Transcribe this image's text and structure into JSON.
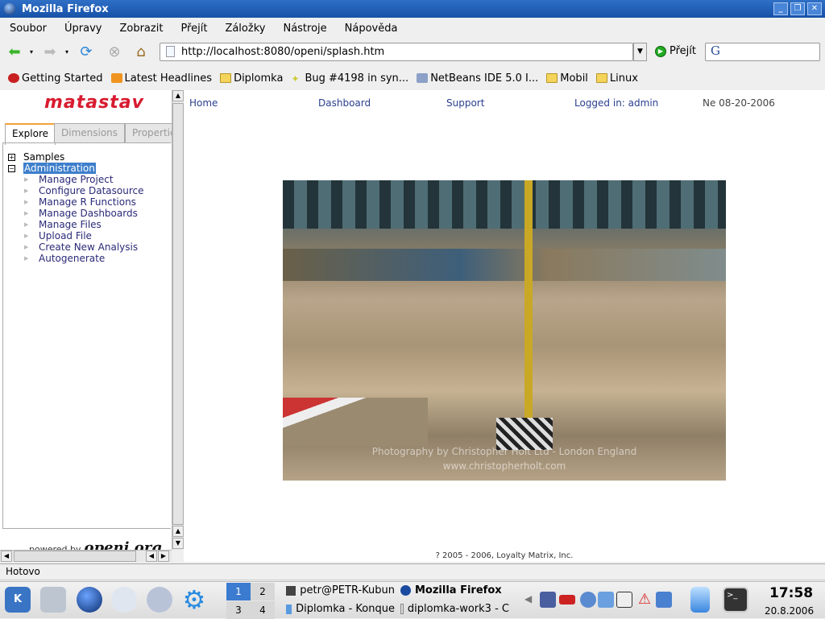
{
  "window": {
    "title": "Mozilla Firefox"
  },
  "menu": [
    "Soubor",
    "Úpravy",
    "Zobrazit",
    "Přejít",
    "Záložky",
    "Nástroje",
    "Nápověda"
  ],
  "toolbar": {
    "url": "http://localhost:8080/openi/splash.htm",
    "go_label": "Přejít",
    "search_value": "",
    "search_engine_icon": "google-icon"
  },
  "bookmarks": [
    {
      "label": "Getting Started",
      "icon": "firefox-icon"
    },
    {
      "label": "Latest Headlines",
      "icon": "rss-icon"
    },
    {
      "label": "Diplomka",
      "icon": "folder-icon"
    },
    {
      "label": "Bug #4198 in syn...",
      "icon": "bug-icon"
    },
    {
      "label": "NetBeans IDE 5.0 I...",
      "icon": "netbeans-icon"
    },
    {
      "label": "Mobil",
      "icon": "folder-icon"
    },
    {
      "label": "Linux",
      "icon": "folder-icon"
    }
  ],
  "sidebar": {
    "brand": "matastav",
    "tabs": [
      "Explore",
      "Dimensions",
      "Properties"
    ],
    "tree": [
      {
        "label": "Samples",
        "expanded": false
      },
      {
        "label": "Administration",
        "expanded": true,
        "selected": true
      }
    ],
    "admin_items": [
      "Manage Project",
      "Configure Datasource",
      "Manage R Functions",
      "Manage Dashboards",
      "Manage Files",
      "Upload File",
      "Create New Analysis",
      "Autogenerate"
    ],
    "powered_by": "powered by",
    "powered_logo": "openi.org"
  },
  "topnav": {
    "home": "Home",
    "dashboard": "Dashboard",
    "support": "Support",
    "logged_in": "Logged in: admin",
    "date": "Ne 08-20-2006"
  },
  "photo": {
    "watermark_line1": "Photography by Christopher Holt Ltd - London England",
    "watermark_line2": "www.christopherholt.com"
  },
  "footer": "? 2005 - 2006, Loyalty Matrix, Inc.",
  "status": "Hotovo",
  "taskbar": {
    "desktops": [
      "1",
      "2",
      "3",
      "4"
    ],
    "tasks": [
      "petr@PETR-Kubun",
      "Mozilla Firefox",
      "Diplomka - Konque",
      "diplomka-work3 - C"
    ],
    "clock": "17:58",
    "date": "20.8.2006"
  }
}
